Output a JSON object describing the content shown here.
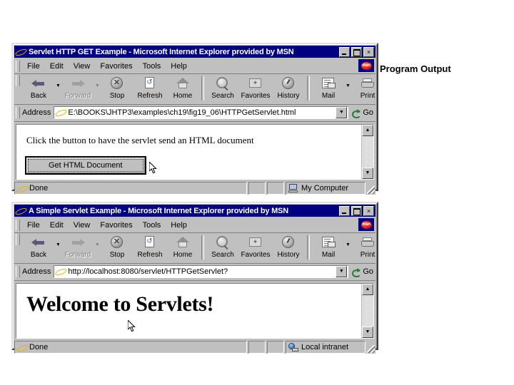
{
  "caption": {
    "text": "Program Output"
  },
  "common": {
    "menu": [
      "File",
      "Edit",
      "View",
      "Favorites",
      "Tools",
      "Help"
    ],
    "toolbar": [
      {
        "label": "Back",
        "icon": "back-arrow-icon",
        "disabled": false,
        "dropdown": true
      },
      {
        "label": "Forward",
        "icon": "forward-arrow-icon",
        "disabled": true,
        "dropdown": true
      },
      {
        "label": "Stop",
        "icon": "stop-icon",
        "disabled": false,
        "dropdown": false
      },
      {
        "label": "Refresh",
        "icon": "refresh-icon",
        "disabled": false,
        "dropdown": false
      },
      {
        "label": "Home",
        "icon": "home-icon",
        "disabled": false,
        "dropdown": false
      },
      {
        "label": "Search",
        "icon": "search-icon",
        "disabled": false,
        "dropdown": false
      },
      {
        "label": "Favorites",
        "icon": "favorites-icon",
        "disabled": false,
        "dropdown": false
      },
      {
        "label": "History",
        "icon": "history-icon",
        "disabled": false,
        "dropdown": false
      },
      {
        "label": "Mail",
        "icon": "mail-icon",
        "disabled": false,
        "dropdown": true
      },
      {
        "label": "Print",
        "icon": "print-icon",
        "disabled": false,
        "dropdown": false
      }
    ],
    "address_label": "Address",
    "go_label": "Go",
    "msn_logo_text": "msn",
    "titlebar_buttons": {
      "minimize": "minimize-button",
      "maximize": "maximize-button",
      "close": "×"
    },
    "status_done": "Done",
    "scroll_up": "▲",
    "scroll_down": "▼",
    "dropdown_arrow": "▼"
  },
  "window_top": {
    "title": "Servlet HTTP GET Example - Microsoft Internet Explorer provided by MSN",
    "address_value": "E:\\BOOKS\\JHTP3\\examples\\ch19\\fig19_06\\HTTPGetServlet.html",
    "content": {
      "paragraph": "Click the button to have the servlet send an HTML document",
      "button_label": "Get HTML Document"
    },
    "status": {
      "message": "Done",
      "zone": "My Computer",
      "zone_icon": "my-computer-icon"
    }
  },
  "window_bottom": {
    "title": "A Simple Servlet Example - Microsoft Internet Explorer provided by MSN",
    "address_value": "http://localhost:8080/servlet/HTTPGetServlet?",
    "content": {
      "heading": "Welcome to Servlets!"
    },
    "status": {
      "message": "Done",
      "zone": "Local intranet",
      "zone_icon": "local-intranet-icon"
    }
  },
  "colors": {
    "titlebar": "#000080",
    "chrome": "#c0c0c0",
    "canvas": "#ffffff",
    "text": "#000000"
  }
}
